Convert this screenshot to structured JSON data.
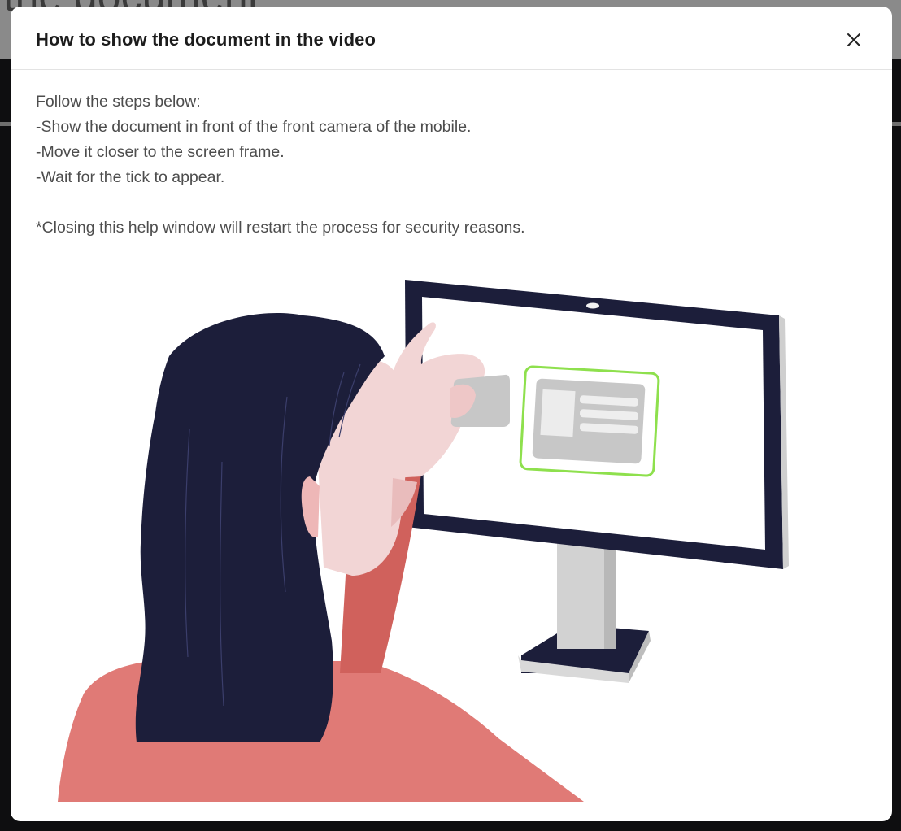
{
  "background": {
    "title_fragment": "the document"
  },
  "modal": {
    "title": "How to show the document in the video",
    "close_icon": "close-icon",
    "intro": "Follow the steps below:",
    "steps": [
      "-Show the document in front of the front camera of the mobile.",
      "-Move it closer to the screen frame.",
      "-Wait for the tick to appear."
    ],
    "note": "*Closing this help window will restart the process for security reasons."
  },
  "colors": {
    "hair": "#1c1e3a",
    "skin": "#f2d5d5",
    "shirt": "#e07a76",
    "monitor_frame": "#1c1e3a",
    "frame_highlight": "#8ee04d",
    "card": "#c7c7c7"
  }
}
